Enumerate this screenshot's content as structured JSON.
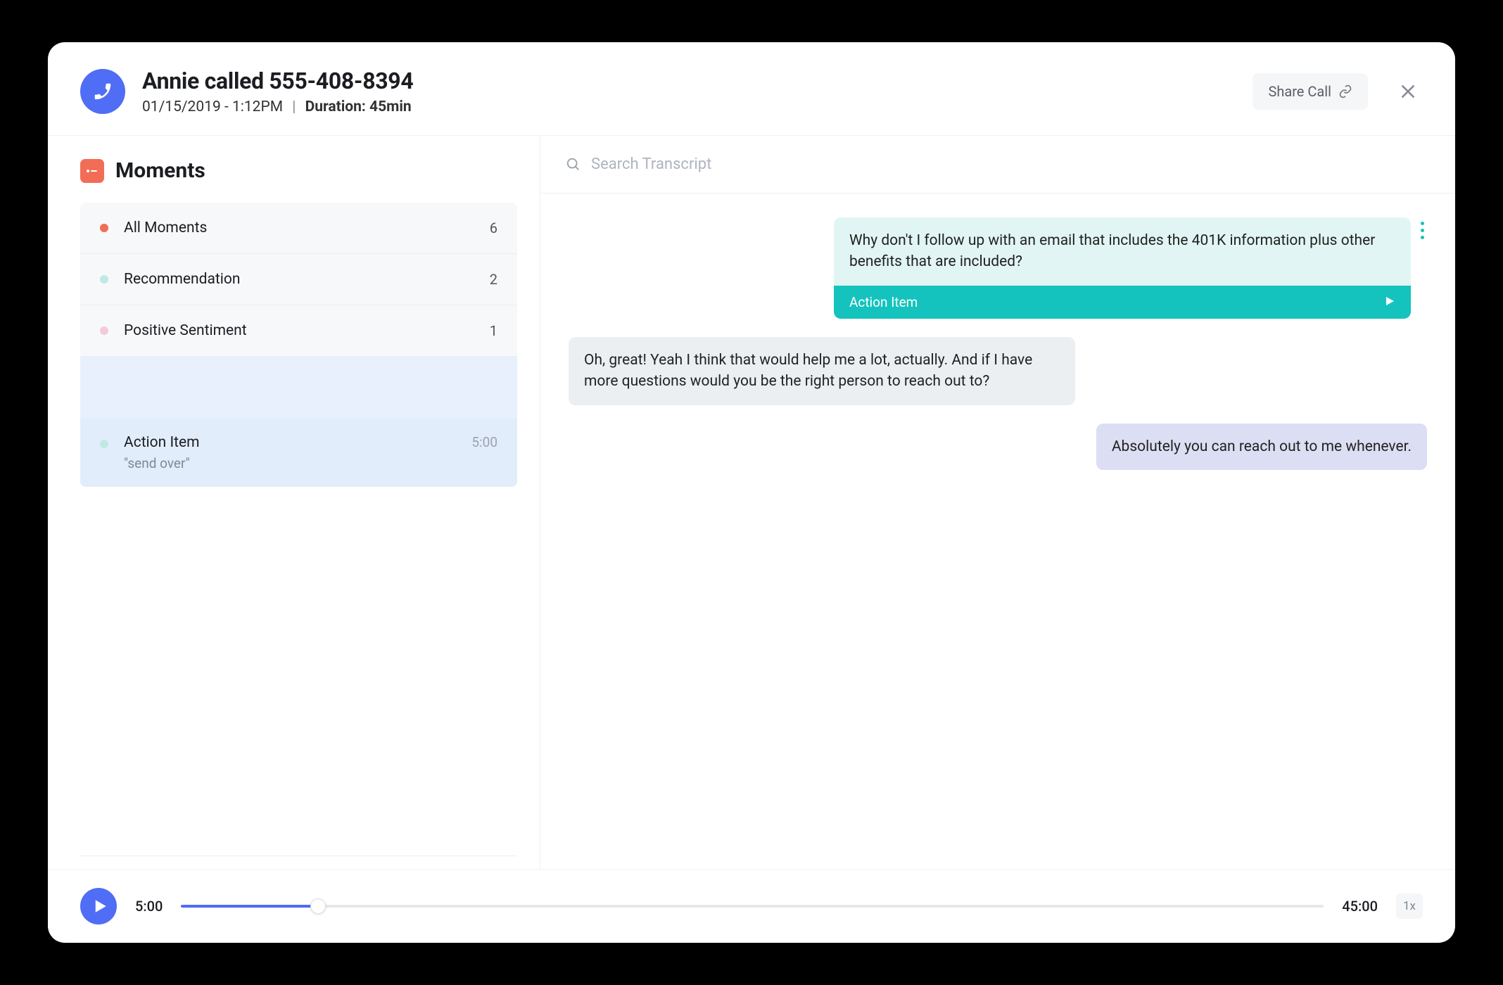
{
  "header": {
    "title": "Annie called 555-408-8394",
    "datetime": "01/15/2019 - 1:12PM",
    "separator": "|",
    "duration_label": "Duration: 45min",
    "share_label": "Share Call"
  },
  "sidebar": {
    "title": "Moments",
    "filters": [
      {
        "label": "All Moments",
        "count": "6",
        "dot": "#f26d55"
      },
      {
        "label": "Recommendation",
        "count": "2",
        "dot": "#bfe9e5"
      },
      {
        "label": "Positive Sentiment",
        "count": "1",
        "dot": "#f6c9d7"
      }
    ],
    "action_item": {
      "label": "Action Item",
      "quote": "\"send over\"",
      "time": "5:00",
      "dot": "#bfe9e5"
    }
  },
  "search": {
    "placeholder": "Search Transcript"
  },
  "transcript": [
    {
      "side": "right",
      "style": "highlight",
      "text": "Why don't I follow up with an email that includes the 401K information plus other benefits that are included?",
      "action_label": "Action Item",
      "has_more": true
    },
    {
      "side": "left",
      "style": "grey",
      "text": "Oh, great! Yeah I think that would help me a lot, actually. And if I have more questions would you be the right person to reach out to?"
    },
    {
      "side": "right",
      "style": "lav",
      "text": "Absolutely you can reach out to me whenever."
    }
  ],
  "player": {
    "current": "5:00",
    "total": "45:00",
    "speed": "1x",
    "progress_pct": 12
  }
}
